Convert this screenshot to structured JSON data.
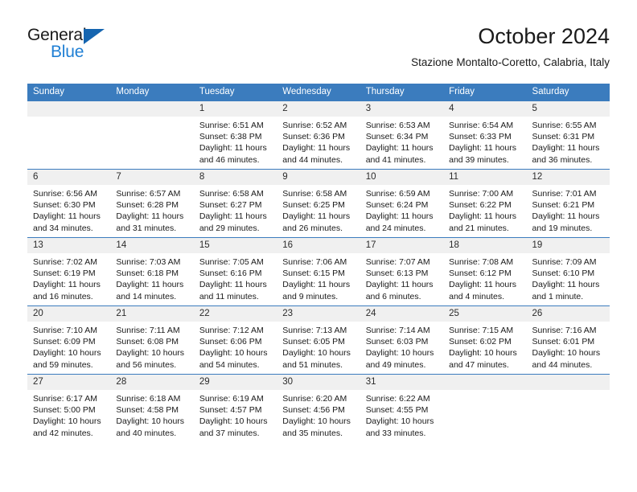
{
  "brand": {
    "name_line1": "General",
    "name_line2": "Blue",
    "color_dark": "#1a1a1a",
    "color_blue": "#1f7fd4",
    "triangle_color": "#1565b0"
  },
  "header": {
    "title": "October 2024",
    "subtitle": "Stazione Montalto-Coretto, Calabria, Italy"
  },
  "theme": {
    "header_bg": "#3b7cbe",
    "header_text": "#ffffff",
    "daynum_bg": "#f0f0f0",
    "cell_bg": "#ffffff",
    "grid_line": "#3b7cbe"
  },
  "weekdays": [
    "Sunday",
    "Monday",
    "Tuesday",
    "Wednesday",
    "Thursday",
    "Friday",
    "Saturday"
  ],
  "weeks": [
    [
      {
        "day": "",
        "sunrise": "",
        "sunset": "",
        "daylight1": "",
        "daylight2": "",
        "empty": true
      },
      {
        "day": "",
        "sunrise": "",
        "sunset": "",
        "daylight1": "",
        "daylight2": "",
        "empty": true
      },
      {
        "day": "1",
        "sunrise": "Sunrise: 6:51 AM",
        "sunset": "Sunset: 6:38 PM",
        "daylight1": "Daylight: 11 hours",
        "daylight2": "and 46 minutes."
      },
      {
        "day": "2",
        "sunrise": "Sunrise: 6:52 AM",
        "sunset": "Sunset: 6:36 PM",
        "daylight1": "Daylight: 11 hours",
        "daylight2": "and 44 minutes."
      },
      {
        "day": "3",
        "sunrise": "Sunrise: 6:53 AM",
        "sunset": "Sunset: 6:34 PM",
        "daylight1": "Daylight: 11 hours",
        "daylight2": "and 41 minutes."
      },
      {
        "day": "4",
        "sunrise": "Sunrise: 6:54 AM",
        "sunset": "Sunset: 6:33 PM",
        "daylight1": "Daylight: 11 hours",
        "daylight2": "and 39 minutes."
      },
      {
        "day": "5",
        "sunrise": "Sunrise: 6:55 AM",
        "sunset": "Sunset: 6:31 PM",
        "daylight1": "Daylight: 11 hours",
        "daylight2": "and 36 minutes."
      }
    ],
    [
      {
        "day": "6",
        "sunrise": "Sunrise: 6:56 AM",
        "sunset": "Sunset: 6:30 PM",
        "daylight1": "Daylight: 11 hours",
        "daylight2": "and 34 minutes."
      },
      {
        "day": "7",
        "sunrise": "Sunrise: 6:57 AM",
        "sunset": "Sunset: 6:28 PM",
        "daylight1": "Daylight: 11 hours",
        "daylight2": "and 31 minutes."
      },
      {
        "day": "8",
        "sunrise": "Sunrise: 6:58 AM",
        "sunset": "Sunset: 6:27 PM",
        "daylight1": "Daylight: 11 hours",
        "daylight2": "and 29 minutes."
      },
      {
        "day": "9",
        "sunrise": "Sunrise: 6:58 AM",
        "sunset": "Sunset: 6:25 PM",
        "daylight1": "Daylight: 11 hours",
        "daylight2": "and 26 minutes."
      },
      {
        "day": "10",
        "sunrise": "Sunrise: 6:59 AM",
        "sunset": "Sunset: 6:24 PM",
        "daylight1": "Daylight: 11 hours",
        "daylight2": "and 24 minutes."
      },
      {
        "day": "11",
        "sunrise": "Sunrise: 7:00 AM",
        "sunset": "Sunset: 6:22 PM",
        "daylight1": "Daylight: 11 hours",
        "daylight2": "and 21 minutes."
      },
      {
        "day": "12",
        "sunrise": "Sunrise: 7:01 AM",
        "sunset": "Sunset: 6:21 PM",
        "daylight1": "Daylight: 11 hours",
        "daylight2": "and 19 minutes."
      }
    ],
    [
      {
        "day": "13",
        "sunrise": "Sunrise: 7:02 AM",
        "sunset": "Sunset: 6:19 PM",
        "daylight1": "Daylight: 11 hours",
        "daylight2": "and 16 minutes."
      },
      {
        "day": "14",
        "sunrise": "Sunrise: 7:03 AM",
        "sunset": "Sunset: 6:18 PM",
        "daylight1": "Daylight: 11 hours",
        "daylight2": "and 14 minutes."
      },
      {
        "day": "15",
        "sunrise": "Sunrise: 7:05 AM",
        "sunset": "Sunset: 6:16 PM",
        "daylight1": "Daylight: 11 hours",
        "daylight2": "and 11 minutes."
      },
      {
        "day": "16",
        "sunrise": "Sunrise: 7:06 AM",
        "sunset": "Sunset: 6:15 PM",
        "daylight1": "Daylight: 11 hours",
        "daylight2": "and 9 minutes."
      },
      {
        "day": "17",
        "sunrise": "Sunrise: 7:07 AM",
        "sunset": "Sunset: 6:13 PM",
        "daylight1": "Daylight: 11 hours",
        "daylight2": "and 6 minutes."
      },
      {
        "day": "18",
        "sunrise": "Sunrise: 7:08 AM",
        "sunset": "Sunset: 6:12 PM",
        "daylight1": "Daylight: 11 hours",
        "daylight2": "and 4 minutes."
      },
      {
        "day": "19",
        "sunrise": "Sunrise: 7:09 AM",
        "sunset": "Sunset: 6:10 PM",
        "daylight1": "Daylight: 11 hours",
        "daylight2": "and 1 minute."
      }
    ],
    [
      {
        "day": "20",
        "sunrise": "Sunrise: 7:10 AM",
        "sunset": "Sunset: 6:09 PM",
        "daylight1": "Daylight: 10 hours",
        "daylight2": "and 59 minutes."
      },
      {
        "day": "21",
        "sunrise": "Sunrise: 7:11 AM",
        "sunset": "Sunset: 6:08 PM",
        "daylight1": "Daylight: 10 hours",
        "daylight2": "and 56 minutes."
      },
      {
        "day": "22",
        "sunrise": "Sunrise: 7:12 AM",
        "sunset": "Sunset: 6:06 PM",
        "daylight1": "Daylight: 10 hours",
        "daylight2": "and 54 minutes."
      },
      {
        "day": "23",
        "sunrise": "Sunrise: 7:13 AM",
        "sunset": "Sunset: 6:05 PM",
        "daylight1": "Daylight: 10 hours",
        "daylight2": "and 51 minutes."
      },
      {
        "day": "24",
        "sunrise": "Sunrise: 7:14 AM",
        "sunset": "Sunset: 6:03 PM",
        "daylight1": "Daylight: 10 hours",
        "daylight2": "and 49 minutes."
      },
      {
        "day": "25",
        "sunrise": "Sunrise: 7:15 AM",
        "sunset": "Sunset: 6:02 PM",
        "daylight1": "Daylight: 10 hours",
        "daylight2": "and 47 minutes."
      },
      {
        "day": "26",
        "sunrise": "Sunrise: 7:16 AM",
        "sunset": "Sunset: 6:01 PM",
        "daylight1": "Daylight: 10 hours",
        "daylight2": "and 44 minutes."
      }
    ],
    [
      {
        "day": "27",
        "sunrise": "Sunrise: 6:17 AM",
        "sunset": "Sunset: 5:00 PM",
        "daylight1": "Daylight: 10 hours",
        "daylight2": "and 42 minutes."
      },
      {
        "day": "28",
        "sunrise": "Sunrise: 6:18 AM",
        "sunset": "Sunset: 4:58 PM",
        "daylight1": "Daylight: 10 hours",
        "daylight2": "and 40 minutes."
      },
      {
        "day": "29",
        "sunrise": "Sunrise: 6:19 AM",
        "sunset": "Sunset: 4:57 PM",
        "daylight1": "Daylight: 10 hours",
        "daylight2": "and 37 minutes."
      },
      {
        "day": "30",
        "sunrise": "Sunrise: 6:20 AM",
        "sunset": "Sunset: 4:56 PM",
        "daylight1": "Daylight: 10 hours",
        "daylight2": "and 35 minutes."
      },
      {
        "day": "31",
        "sunrise": "Sunrise: 6:22 AM",
        "sunset": "Sunset: 4:55 PM",
        "daylight1": "Daylight: 10 hours",
        "daylight2": "and 33 minutes."
      },
      {
        "day": "",
        "sunrise": "",
        "sunset": "",
        "daylight1": "",
        "daylight2": "",
        "empty": true
      },
      {
        "day": "",
        "sunrise": "",
        "sunset": "",
        "daylight1": "",
        "daylight2": "",
        "empty": true
      }
    ]
  ]
}
